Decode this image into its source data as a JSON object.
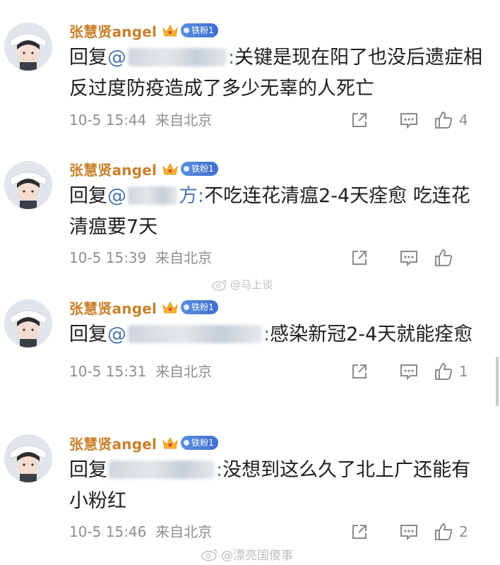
{
  "user": {
    "name": "张慧贤angel",
    "badge": "铁粉1"
  },
  "comments": [
    {
      "prefix": "回复",
      "mention_tail": ":",
      "body": "关键是现在阳了也没后遗症相反过度防疫造成了多少无辜的人死亡",
      "time": "10-5 15:44",
      "location": "来自北京",
      "likes": "4"
    },
    {
      "prefix": "回复",
      "mention_tail": "方:",
      "body": "不吃连花清瘟2-4天痊愈 吃连花清瘟要7天",
      "time": "10-5 15:39",
      "location": "来自北京",
      "likes": ""
    },
    {
      "prefix": "回复",
      "mention_tail": ":",
      "body": "感染新冠2-4天就能痊愈",
      "time": "10-5 15:31",
      "location": "来自北京",
      "likes": "1"
    },
    {
      "prefix": "回复",
      "mention_tail": ":",
      "body": "没想到这么久了北上广还能有小粉红",
      "time": "10-5 15:46",
      "location": "来自北京",
      "likes": "2"
    }
  ],
  "watermarks": {
    "middle": "@马上谈",
    "bottom": "@漂亮国傻事"
  },
  "colors": {
    "username": "#c8802a",
    "mention": "#4c77b0",
    "meta": "#8e8e8e",
    "badge": "#3f6fcf"
  },
  "icons": [
    "share-icon",
    "comment-icon",
    "like-icon",
    "crown-icon",
    "weibo-icon"
  ]
}
